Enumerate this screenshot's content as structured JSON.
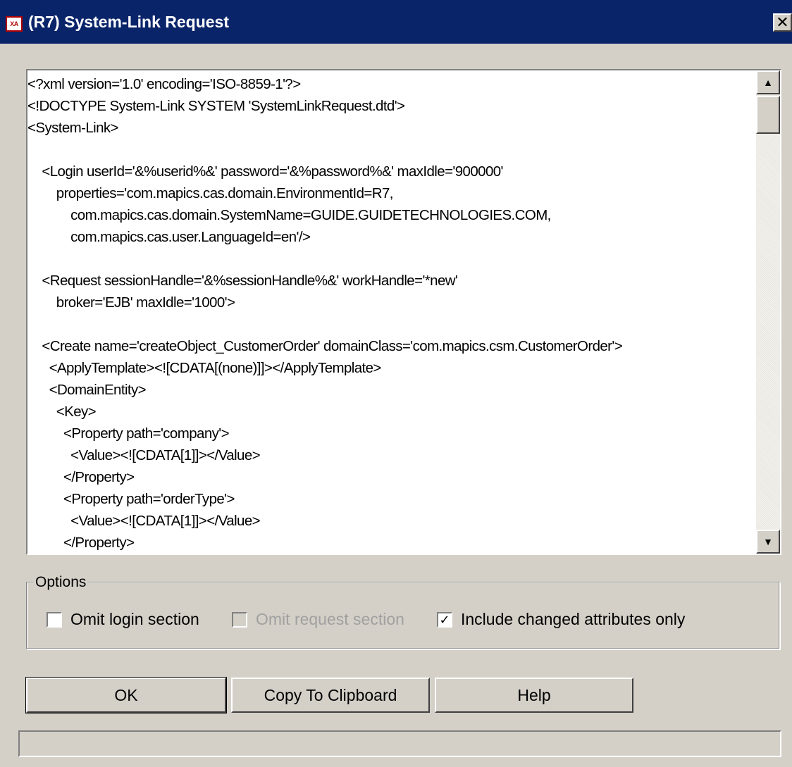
{
  "window": {
    "title": "(R7) System-Link Request",
    "icon_name": "xa-app-icon",
    "icon_text": "XA",
    "close_label": "✕"
  },
  "xml_lines": [
    "<?xml version='1.0' encoding='ISO-8859-1'?>",
    "<!DOCTYPE System-Link SYSTEM 'SystemLinkRequest.dtd'>",
    "<System-Link>",
    "",
    "    <Login userId='&%userid%&' password='&%password%&' maxIdle='900000'",
    "        properties='com.mapics.cas.domain.EnvironmentId=R7,",
    "            com.mapics.cas.domain.SystemName=GUIDE.GUIDETECHNOLOGIES.COM,",
    "            com.mapics.cas.user.LanguageId=en'/>",
    "",
    "    <Request sessionHandle='&%sessionHandle%&' workHandle='*new'",
    "        broker='EJB' maxIdle='1000'>",
    "",
    "    <Create name='createObject_CustomerOrder' domainClass='com.mapics.csm.CustomerOrder'>",
    "      <ApplyTemplate><![CDATA[(none)]]></ApplyTemplate>",
    "      <DomainEntity>",
    "        <Key>",
    "          <Property path='company'>",
    "            <Value><![CDATA[1]]></Value>",
    "          </Property>",
    "          <Property path='orderType'>",
    "            <Value><![CDATA[1]]></Value>",
    "          </Property>"
  ],
  "options": {
    "legend": "Options",
    "omit_login": {
      "label": "Omit login section",
      "checked": false,
      "enabled": true
    },
    "omit_request": {
      "label": "Omit request section",
      "checked": false,
      "enabled": false
    },
    "changed_only": {
      "label": "Include changed attributes only",
      "checked": true,
      "enabled": true
    }
  },
  "buttons": {
    "ok": "OK",
    "copy": "Copy To Clipboard",
    "help": "Help"
  },
  "scrollbar": {
    "up_glyph": "▲",
    "down_glyph": "▼"
  },
  "check_glyph": "✓",
  "colors": {
    "titlebar": "#0a246a",
    "face": "#d4d0c8",
    "disabled_text": "#a0a0a0"
  }
}
